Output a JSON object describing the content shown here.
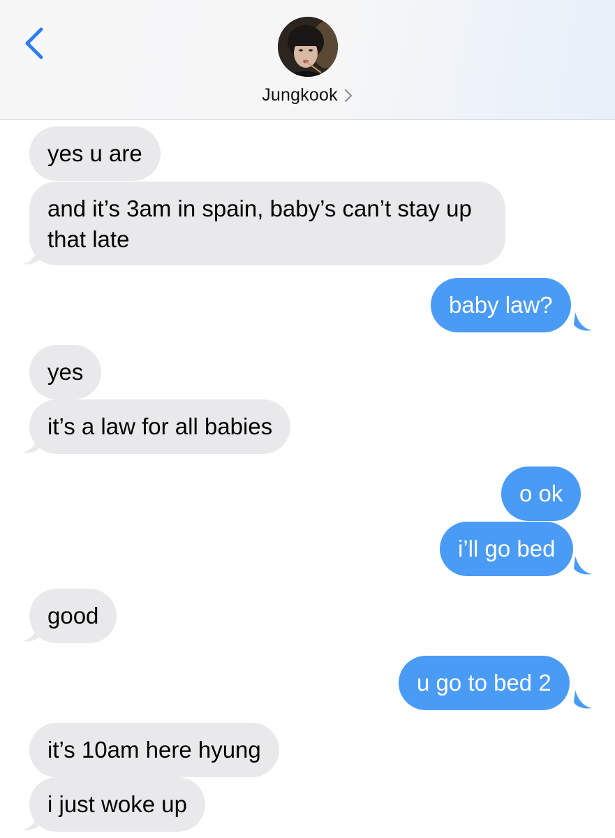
{
  "header": {
    "contact_name": "Jungkook"
  },
  "messages": [
    {
      "direction": "incoming",
      "text": "yes u are"
    },
    {
      "direction": "incoming",
      "text": "and it’s 3am in spain, baby’s can’t stay up that late"
    },
    {
      "direction": "outgoing",
      "text": "baby law?"
    },
    {
      "direction": "incoming",
      "text": "yes"
    },
    {
      "direction": "incoming",
      "text": "it’s a law for all babies"
    },
    {
      "direction": "outgoing",
      "text": "o ok"
    },
    {
      "direction": "outgoing",
      "text": "i’ll go bed"
    },
    {
      "direction": "incoming",
      "text": "good"
    },
    {
      "direction": "outgoing",
      "text": "u go to bed 2"
    },
    {
      "direction": "incoming",
      "text": "it’s 10am here hyung"
    },
    {
      "direction": "incoming",
      "text": "i just woke up"
    }
  ],
  "colors": {
    "incoming_bubble": "#e9e9eb",
    "outgoing_bubble": "#4a9bf5",
    "accent": "#2f7cf6"
  }
}
